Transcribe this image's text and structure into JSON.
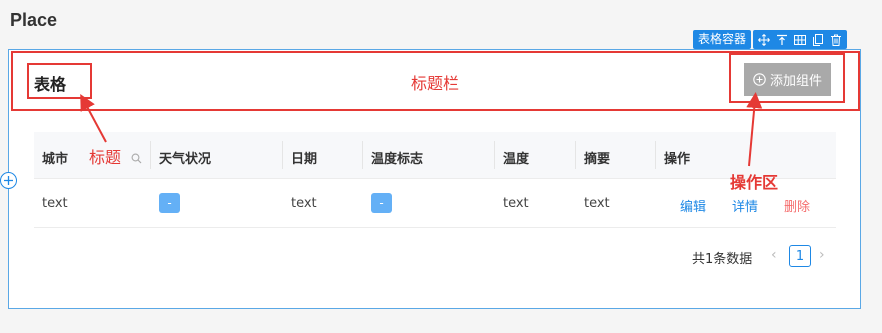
{
  "place": {
    "title": "Place"
  },
  "toolbar": {
    "label": "表格容器",
    "icons": [
      "move-icon",
      "align-top-icon",
      "grid-icon",
      "copy-icon",
      "delete-icon"
    ]
  },
  "header": {
    "table_title": "表格",
    "add_button_label": "添加组件"
  },
  "table": {
    "columns": [
      "城市",
      "天气状况",
      "日期",
      "温度标志",
      "温度",
      "摘要",
      "操作"
    ],
    "rows": [
      {
        "city": "text",
        "weather": "-",
        "date": "text",
        "temp_flag": "-",
        "temp": "text",
        "summary": "text",
        "actions": [
          "编辑",
          "详情",
          "删除"
        ]
      }
    ]
  },
  "pagination": {
    "total_text": "共1条数据",
    "current_page": "1"
  },
  "annotations": {
    "title_label": "标题",
    "titlebar_label": "标题栏",
    "action_area_label": "操作区"
  },
  "colors": {
    "accent": "#1e88e5",
    "annotation": "#e53935",
    "danger": "#f56c6c",
    "tag": "#64b0f6"
  }
}
